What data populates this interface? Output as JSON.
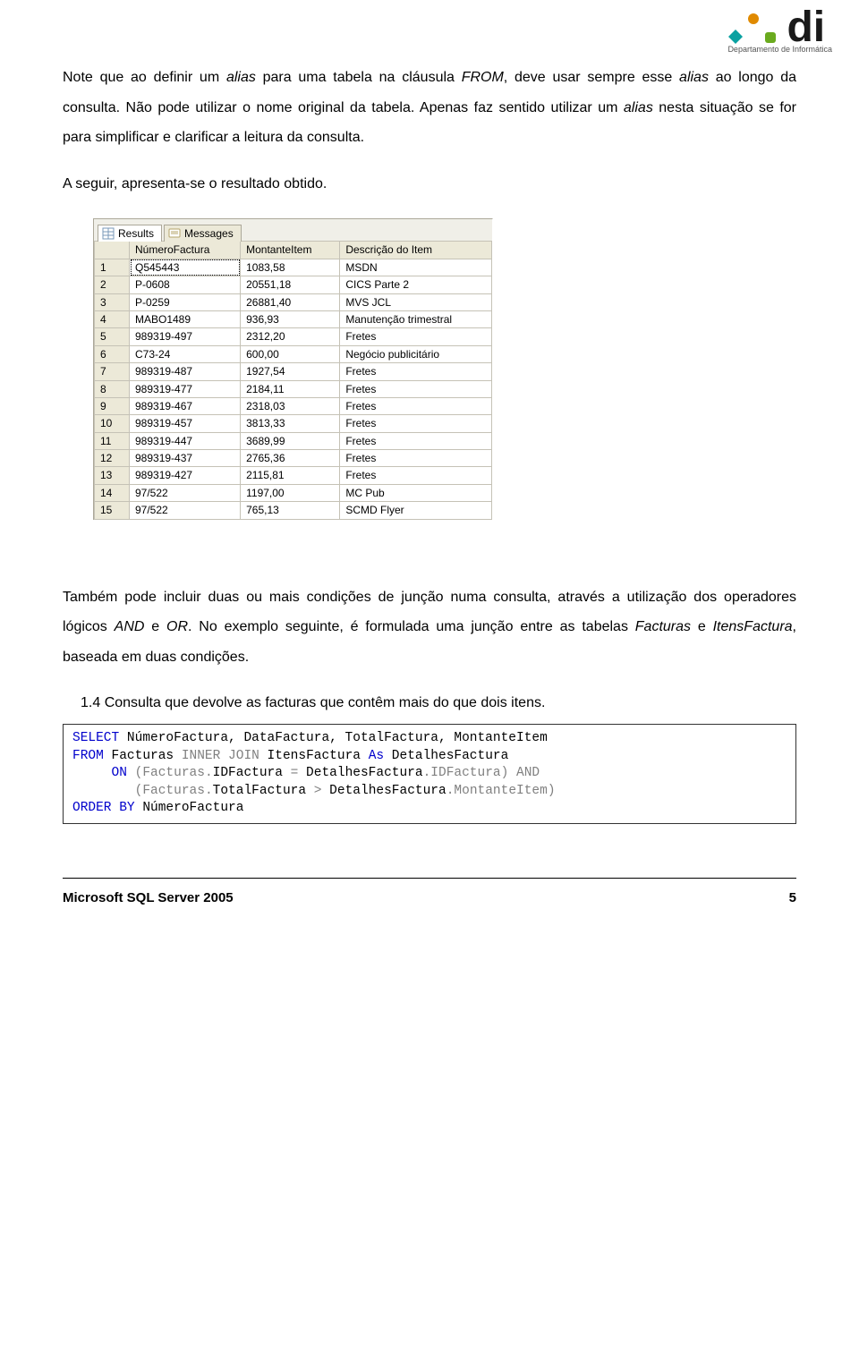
{
  "logo": {
    "brand": "di",
    "dept": "Departamento de Informática"
  },
  "para1a": "Note que ao definir um ",
  "para1b": "alias",
  "para1c": " para uma tabela na cláusula ",
  "para1d": "FROM",
  "para1e": ", deve usar sempre esse ",
  "para1f": "alias",
  "para1g": " ao longo da consulta. Não pode utilizar o nome original da tabela. Apenas faz sentido utilizar um ",
  "para1h": "alias",
  "para1i": " nesta situação se for para simplificar e clarificar a leitura da consulta.",
  "para2": "A seguir, apresenta-se o resultado obtido.",
  "tabs": {
    "results": "Results",
    "messages": "Messages"
  },
  "columns": [
    "",
    "NúmeroFactura",
    "MontanteItem",
    "Descrição do Item"
  ],
  "rows": [
    [
      "1",
      "Q545443",
      "1083,58",
      "MSDN"
    ],
    [
      "2",
      "P-0608",
      "20551,18",
      "CICS Parte 2"
    ],
    [
      "3",
      "P-0259",
      "26881,40",
      "MVS JCL"
    ],
    [
      "4",
      "MABO1489",
      "936,93",
      "Manutenção trimestral"
    ],
    [
      "5",
      "989319-497",
      "2312,20",
      "Fretes"
    ],
    [
      "6",
      "C73-24",
      "600,00",
      "Negócio publicitário"
    ],
    [
      "7",
      "989319-487",
      "1927,54",
      "Fretes"
    ],
    [
      "8",
      "989319-477",
      "2184,11",
      "Fretes"
    ],
    [
      "9",
      "989319-467",
      "2318,03",
      "Fretes"
    ],
    [
      "10",
      "989319-457",
      "3813,33",
      "Fretes"
    ],
    [
      "11",
      "989319-447",
      "3689,99",
      "Fretes"
    ],
    [
      "12",
      "989319-437",
      "2765,36",
      "Fretes"
    ],
    [
      "13",
      "989319-427",
      "2115,81",
      "Fretes"
    ],
    [
      "14",
      "97/522",
      "1197,00",
      "MC Pub"
    ],
    [
      "15",
      "97/522",
      "765,13",
      "SCMD Flyer"
    ]
  ],
  "para3a": "Também pode incluir duas ou mais condições de junção numa consulta, através a utilização dos operadores lógicos ",
  "para3b": "AND",
  "para3c": " e ",
  "para3d": "OR",
  "para3e": ". No exemplo seguinte, é formulada uma junção entre as tabelas ",
  "para3f": "Facturas",
  "para3g": " e ",
  "para3h": "ItensFactura",
  "para3i": ", baseada em duas condições.",
  "section14": "1.4   Consulta que devolve as facturas que contêm mais do que dois itens.",
  "sql": {
    "l1_select": "SELECT",
    "l1_cols": " NúmeroFactura, DataFactura, TotalFactura, MontanteItem",
    "l2_from": "FROM",
    "l2_t1": " Facturas ",
    "l2_inner": "INNER",
    "l2_sp1": " ",
    "l2_join": "JOIN",
    "l2_t2": " ItensFactura ",
    "l2_as": "As",
    "l2_alias": " DetalhesFactura",
    "l3_pad": "     ",
    "l3_on": "ON",
    "l3_a": " (Facturas",
    "l3_dot1": ".",
    "l3_b": "IDFactura ",
    "l3_eq": "=",
    "l3_c": " DetalhesFactura",
    "l3_dot2": ".",
    "l3_d": "IDFactura) ",
    "l3_and": "AND",
    "l4_pad": "        ",
    "l4_a": "(Facturas",
    "l4_dot1": ".",
    "l4_b": "TotalFactura ",
    "l4_gt": ">",
    "l4_c": " DetalhesFactura",
    "l4_dot2": ".",
    "l4_d": "MontanteItem)",
    "l5_order": "ORDER",
    "l5_sp": " ",
    "l5_by": "BY",
    "l5_col": " NúmeroFactura"
  },
  "footer": {
    "left": "Microsoft SQL Server 2005",
    "right": "5"
  }
}
